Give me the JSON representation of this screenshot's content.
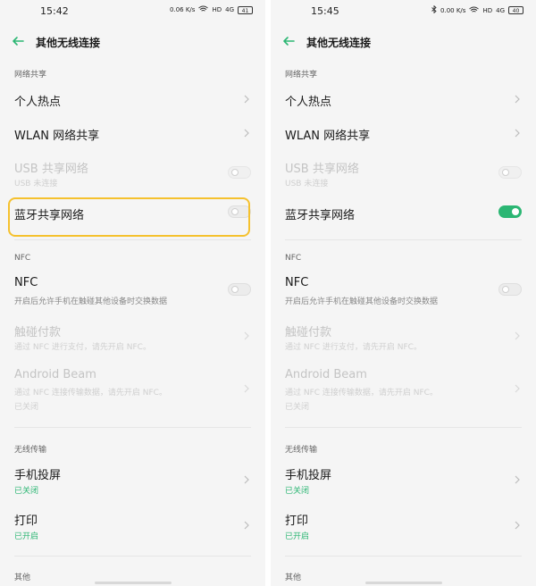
{
  "left": {
    "status": {
      "time": "15:42",
      "speed": "0.06 K/s",
      "hd": "HD",
      "signal": "4G",
      "battery": "41"
    },
    "header": {
      "title": "其他无线连接"
    },
    "sections": {
      "sharing": "网络共享",
      "nfc": "NFC",
      "wireless": "无线传输",
      "other": "其他"
    },
    "rows": {
      "hotspot": "个人热点",
      "wlan_share": "WLAN 网络共享",
      "usb_share": "USB 共享网络",
      "usb_sub": "USB 未连接",
      "bt_share": "蓝牙共享网络",
      "nfc": "NFC",
      "nfc_sub": "开启后允许手机在触碰其他设备时交换数据",
      "tap_pay": "触碰付款",
      "tap_pay_sub": "通过 NFC 进行支付，请先开启 NFC。",
      "beam": "Android Beam",
      "beam_sub": "通过 NFC 连接传输数据，请先开启 NFC。",
      "beam_state": "已关闭",
      "cast": "手机投屏",
      "cast_state": "已关闭",
      "print": "打印",
      "print_state": "已开启"
    },
    "toggles": {
      "usb_share": false,
      "bt_share": false,
      "nfc": false
    }
  },
  "right": {
    "status": {
      "time": "15:45",
      "speed": "0.00 K/s",
      "hd": "HD",
      "signal": "4G",
      "battery": "40"
    },
    "header": {
      "title": "其他无线连接"
    },
    "sections": {
      "sharing": "网络共享",
      "nfc": "NFC",
      "wireless": "无线传输",
      "other": "其他"
    },
    "rows": {
      "hotspot": "个人热点",
      "wlan_share": "WLAN 网络共享",
      "usb_share": "USB 共享网络",
      "usb_sub": "USB 未连接",
      "bt_share": "蓝牙共享网络",
      "nfc": "NFC",
      "nfc_sub": "开启后允许手机在触碰其他设备时交换数据",
      "tap_pay": "触碰付款",
      "tap_pay_sub": "通过 NFC 进行支付，请先开启 NFC。",
      "beam": "Android Beam",
      "beam_sub": "通过 NFC 连接传输数据，请先开启 NFC。",
      "beam_state": "已关闭",
      "cast": "手机投屏",
      "cast_state": "已关闭",
      "print": "打印",
      "print_state": "已开启"
    },
    "toggles": {
      "usb_share": false,
      "bt_share": true,
      "nfc": false
    }
  },
  "colors": {
    "accent": "#2bb673",
    "highlight": "#f5c12e",
    "disabled_text": "#c4c4c4"
  }
}
